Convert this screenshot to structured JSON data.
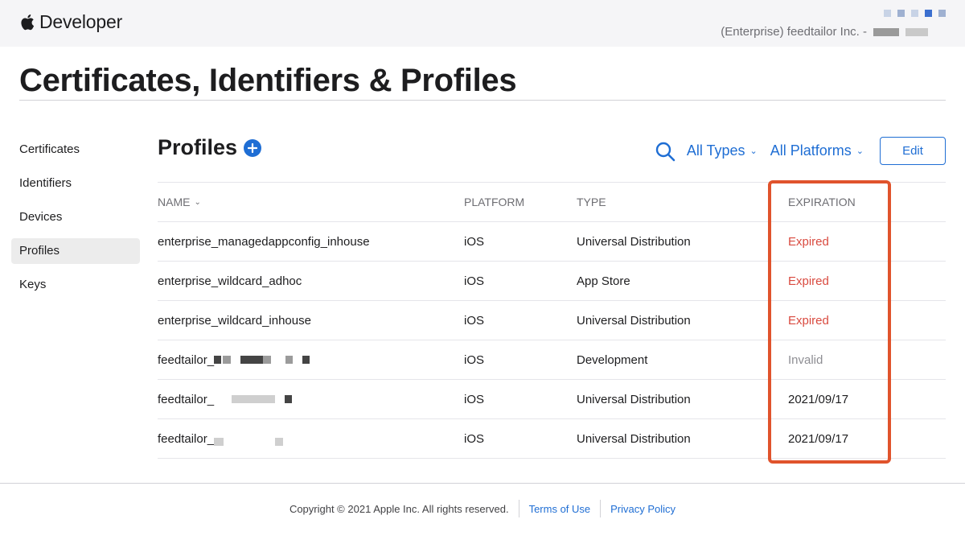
{
  "header": {
    "brand": "Developer",
    "account_text": "(Enterprise) feedtailor Inc. -"
  },
  "page_title": "Certificates, Identifiers & Profiles",
  "sidebar": {
    "items": [
      {
        "label": "Certificates",
        "active": false
      },
      {
        "label": "Identifiers",
        "active": false
      },
      {
        "label": "Devices",
        "active": false
      },
      {
        "label": "Profiles",
        "active": true
      },
      {
        "label": "Keys",
        "active": false
      }
    ]
  },
  "main": {
    "heading": "Profiles",
    "filters": {
      "types": "All Types",
      "platforms": "All Platforms"
    },
    "edit_label": "Edit"
  },
  "table": {
    "headers": {
      "name": "NAME",
      "platform": "PLATFORM",
      "type": "TYPE",
      "expiration": "EXPIRATION"
    },
    "rows": [
      {
        "name": "enterprise_managedappconfig_inhouse",
        "platform": "iOS",
        "type": "Universal Distribution",
        "expiration": "Expired"
      },
      {
        "name": "enterprise_wildcard_adhoc",
        "platform": "iOS",
        "type": "App Store",
        "expiration": "Expired"
      },
      {
        "name": "enterprise_wildcard_inhouse",
        "platform": "iOS",
        "type": "Universal Distribution",
        "expiration": "Expired"
      },
      {
        "name": "feedtailor_",
        "platform": "iOS",
        "type": "Development",
        "expiration": "Invalid"
      },
      {
        "name": "feedtailor_",
        "platform": "iOS",
        "type": "Universal Distribution",
        "expiration": "2021/09/17"
      },
      {
        "name": "feedtailor_",
        "platform": "iOS",
        "type": "Universal Distribution",
        "expiration": "2021/09/17"
      }
    ]
  },
  "footer": {
    "copyright": "Copyright © 2021 Apple Inc. All rights reserved.",
    "terms": "Terms of Use",
    "privacy": "Privacy Policy"
  },
  "colors": {
    "accent": "#1f6ed4",
    "expired": "#d94a3f",
    "highlight_box": "#e0532c"
  },
  "icons": [
    "apple-logo-icon",
    "plus-circle-icon",
    "search-icon",
    "chevron-down-icon"
  ]
}
